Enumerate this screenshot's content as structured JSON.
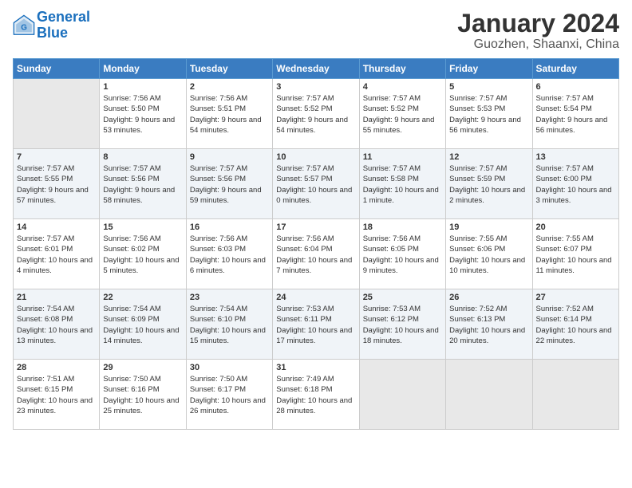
{
  "logo": {
    "text1": "General",
    "text2": "Blue"
  },
  "title": "January 2024",
  "subtitle": "Guozhen, Shaanxi, China",
  "weekdays": [
    "Sunday",
    "Monday",
    "Tuesday",
    "Wednesday",
    "Thursday",
    "Friday",
    "Saturday"
  ],
  "weeks": [
    [
      {
        "day": "",
        "empty": true
      },
      {
        "day": "1",
        "sunrise": "7:56 AM",
        "sunset": "5:50 PM",
        "daylight": "9 hours and 53 minutes."
      },
      {
        "day": "2",
        "sunrise": "7:56 AM",
        "sunset": "5:51 PM",
        "daylight": "9 hours and 54 minutes."
      },
      {
        "day": "3",
        "sunrise": "7:57 AM",
        "sunset": "5:52 PM",
        "daylight": "9 hours and 54 minutes."
      },
      {
        "day": "4",
        "sunrise": "7:57 AM",
        "sunset": "5:52 PM",
        "daylight": "9 hours and 55 minutes."
      },
      {
        "day": "5",
        "sunrise": "7:57 AM",
        "sunset": "5:53 PM",
        "daylight": "9 hours and 56 minutes."
      },
      {
        "day": "6",
        "sunrise": "7:57 AM",
        "sunset": "5:54 PM",
        "daylight": "9 hours and 56 minutes."
      }
    ],
    [
      {
        "day": "7",
        "sunrise": "7:57 AM",
        "sunset": "5:55 PM",
        "daylight": "9 hours and 57 minutes."
      },
      {
        "day": "8",
        "sunrise": "7:57 AM",
        "sunset": "5:56 PM",
        "daylight": "9 hours and 58 minutes."
      },
      {
        "day": "9",
        "sunrise": "7:57 AM",
        "sunset": "5:56 PM",
        "daylight": "9 hours and 59 minutes."
      },
      {
        "day": "10",
        "sunrise": "7:57 AM",
        "sunset": "5:57 PM",
        "daylight": "10 hours and 0 minutes."
      },
      {
        "day": "11",
        "sunrise": "7:57 AM",
        "sunset": "5:58 PM",
        "daylight": "10 hours and 1 minute."
      },
      {
        "day": "12",
        "sunrise": "7:57 AM",
        "sunset": "5:59 PM",
        "daylight": "10 hours and 2 minutes."
      },
      {
        "day": "13",
        "sunrise": "7:57 AM",
        "sunset": "6:00 PM",
        "daylight": "10 hours and 3 minutes."
      }
    ],
    [
      {
        "day": "14",
        "sunrise": "7:57 AM",
        "sunset": "6:01 PM",
        "daylight": "10 hours and 4 minutes."
      },
      {
        "day": "15",
        "sunrise": "7:56 AM",
        "sunset": "6:02 PM",
        "daylight": "10 hours and 5 minutes."
      },
      {
        "day": "16",
        "sunrise": "7:56 AM",
        "sunset": "6:03 PM",
        "daylight": "10 hours and 6 minutes."
      },
      {
        "day": "17",
        "sunrise": "7:56 AM",
        "sunset": "6:04 PM",
        "daylight": "10 hours and 7 minutes."
      },
      {
        "day": "18",
        "sunrise": "7:56 AM",
        "sunset": "6:05 PM",
        "daylight": "10 hours and 9 minutes."
      },
      {
        "day": "19",
        "sunrise": "7:55 AM",
        "sunset": "6:06 PM",
        "daylight": "10 hours and 10 minutes."
      },
      {
        "day": "20",
        "sunrise": "7:55 AM",
        "sunset": "6:07 PM",
        "daylight": "10 hours and 11 minutes."
      }
    ],
    [
      {
        "day": "21",
        "sunrise": "7:54 AM",
        "sunset": "6:08 PM",
        "daylight": "10 hours and 13 minutes."
      },
      {
        "day": "22",
        "sunrise": "7:54 AM",
        "sunset": "6:09 PM",
        "daylight": "10 hours and 14 minutes."
      },
      {
        "day": "23",
        "sunrise": "7:54 AM",
        "sunset": "6:10 PM",
        "daylight": "10 hours and 15 minutes."
      },
      {
        "day": "24",
        "sunrise": "7:53 AM",
        "sunset": "6:11 PM",
        "daylight": "10 hours and 17 minutes."
      },
      {
        "day": "25",
        "sunrise": "7:53 AM",
        "sunset": "6:12 PM",
        "daylight": "10 hours and 18 minutes."
      },
      {
        "day": "26",
        "sunrise": "7:52 AM",
        "sunset": "6:13 PM",
        "daylight": "10 hours and 20 minutes."
      },
      {
        "day": "27",
        "sunrise": "7:52 AM",
        "sunset": "6:14 PM",
        "daylight": "10 hours and 22 minutes."
      }
    ],
    [
      {
        "day": "28",
        "sunrise": "7:51 AM",
        "sunset": "6:15 PM",
        "daylight": "10 hours and 23 minutes."
      },
      {
        "day": "29",
        "sunrise": "7:50 AM",
        "sunset": "6:16 PM",
        "daylight": "10 hours and 25 minutes."
      },
      {
        "day": "30",
        "sunrise": "7:50 AM",
        "sunset": "6:17 PM",
        "daylight": "10 hours and 26 minutes."
      },
      {
        "day": "31",
        "sunrise": "7:49 AM",
        "sunset": "6:18 PM",
        "daylight": "10 hours and 28 minutes."
      },
      {
        "day": "",
        "empty": true
      },
      {
        "day": "",
        "empty": true
      },
      {
        "day": "",
        "empty": true
      }
    ]
  ],
  "labels": {
    "sunrise": "Sunrise:",
    "sunset": "Sunset:",
    "daylight": "Daylight:"
  }
}
